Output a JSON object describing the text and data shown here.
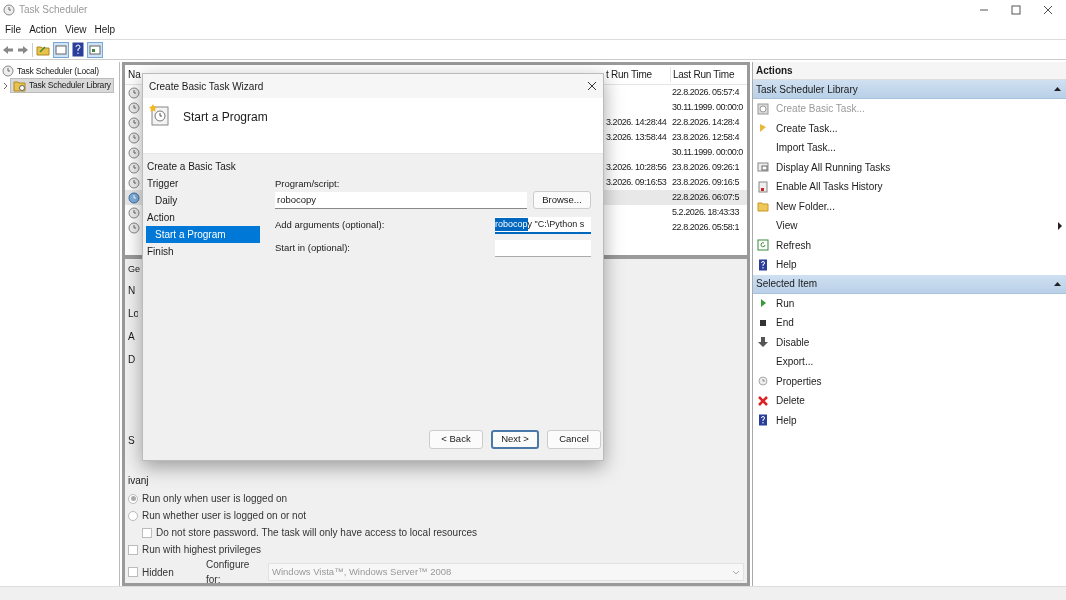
{
  "window": {
    "title": "Task Scheduler"
  },
  "menu": [
    "File",
    "Action",
    "View",
    "Help"
  ],
  "tree": [
    {
      "label": "Task Scheduler (Local)",
      "selected": false,
      "children": [
        {
          "label": "Task Scheduler Library",
          "selected": true,
          "expanded": false
        }
      ]
    }
  ],
  "task_list": {
    "columns": [
      "Na",
      "t Run Time",
      "Last Run Time"
    ],
    "rows": [
      {
        "next_run": "",
        "last_run": "22.8.2026. 05:57:4",
        "selected": false
      },
      {
        "next_run": "",
        "last_run": "30.11.1999. 00:00:0",
        "selected": false
      },
      {
        "next_run": "3.2026. 14:28:44",
        "last_run": "22.8.2026. 14:28:4",
        "selected": false
      },
      {
        "next_run": "3.2026. 13:58:44",
        "last_run": "23.8.2026. 12:58:4",
        "selected": false
      },
      {
        "next_run": "",
        "last_run": "30.11.1999. 00:00:0",
        "selected": false
      },
      {
        "next_run": "3.2026. 10:28:56",
        "last_run": "23.8.2026. 09:26:1",
        "selected": false
      },
      {
        "next_run": "3.2026. 09:16:53",
        "last_run": "23.8.2026. 09:16:5",
        "selected": false
      },
      {
        "next_run": "",
        "last_run": "22.8.2026. 06:07:5",
        "selected": true
      },
      {
        "next_run": "",
        "last_run": "5.2.2026. 18:43:33",
        "selected": false
      },
      {
        "next_run": "",
        "last_run": "22.8.2026. 05:58:1",
        "selected": false
      }
    ]
  },
  "details": {
    "tab": "Ge",
    "field_labels": [
      "N",
      "Lo",
      "A",
      "D"
    ],
    "section": "S",
    "user": "ivanj",
    "options": [
      {
        "kind": "radio",
        "label": "Run only when user is logged on",
        "checked": true,
        "indented": false
      },
      {
        "kind": "radio",
        "label": "Run whether user is logged on or not",
        "checked": false,
        "indented": false
      },
      {
        "kind": "checkbox",
        "label": "Do not store password.  The task will only have access to local resources",
        "checked": false,
        "indented": true
      },
      {
        "kind": "checkbox",
        "label": "Run with highest privileges",
        "checked": false,
        "indented": false
      }
    ],
    "hidden": {
      "label": "Hidden",
      "checked": false
    },
    "configure_label": "Configure for:",
    "configure_value": "Windows Vista™, Windows Server™ 2008"
  },
  "dialog": {
    "title": "Create Basic Task Wizard",
    "heading": "Start a Program",
    "steps": [
      {
        "label": "Create a Basic Task",
        "selected": false
      },
      {
        "label": "Trigger",
        "selected": false,
        "children": [
          {
            "label": "Daily",
            "selected": false
          }
        ]
      },
      {
        "label": "Action",
        "selected": false,
        "children": [
          {
            "label": "Start a Program",
            "selected": true
          }
        ]
      },
      {
        "label": "Finish",
        "selected": false
      }
    ],
    "program_label": "Program/script:",
    "program_value": "robocopy",
    "browse": "Browse...",
    "arguments_label": "Add arguments (optional):",
    "arguments_selected": "robocop",
    "arguments_rest": "y \"C:\\Python s",
    "start_in_label": "Start in (optional):",
    "buttons": [
      {
        "label": "< Back",
        "default": false
      },
      {
        "label": "Next >",
        "default": true
      },
      {
        "label": "Cancel",
        "default": false
      }
    ]
  },
  "actions": {
    "title": "Actions",
    "sections": [
      {
        "title": "Task Scheduler Library",
        "expanded": true,
        "items": [
          {
            "label": "Create Basic Task...",
            "disabled": true,
            "submenu": false
          },
          {
            "label": "Create Task...",
            "disabled": false,
            "submenu": false
          },
          {
            "label": "Import Task...",
            "disabled": false,
            "submenu": false
          },
          {
            "label": "Display All Running Tasks",
            "disabled": false,
            "submenu": false
          },
          {
            "label": "Enable All Tasks History",
            "disabled": false,
            "submenu": false
          },
          {
            "label": "New Folder...",
            "disabled": false,
            "submenu": false
          },
          {
            "label": "View",
            "disabled": false,
            "submenu": true
          },
          {
            "label": "Refresh",
            "disabled": false,
            "submenu": false
          },
          {
            "label": "Help",
            "disabled": false,
            "submenu": false
          }
        ]
      },
      {
        "title": "Selected Item",
        "expanded": true,
        "items": [
          {
            "label": "Run",
            "disabled": false,
            "submenu": false
          },
          {
            "label": "End",
            "disabled": false,
            "submenu": false
          },
          {
            "label": "Disable",
            "disabled": false,
            "submenu": false
          },
          {
            "label": "Export...",
            "disabled": false,
            "submenu": false
          },
          {
            "label": "Properties",
            "disabled": false,
            "submenu": false
          },
          {
            "label": "Delete",
            "disabled": false,
            "submenu": false
          },
          {
            "label": "Help",
            "disabled": false,
            "submenu": false
          }
        ]
      }
    ]
  }
}
